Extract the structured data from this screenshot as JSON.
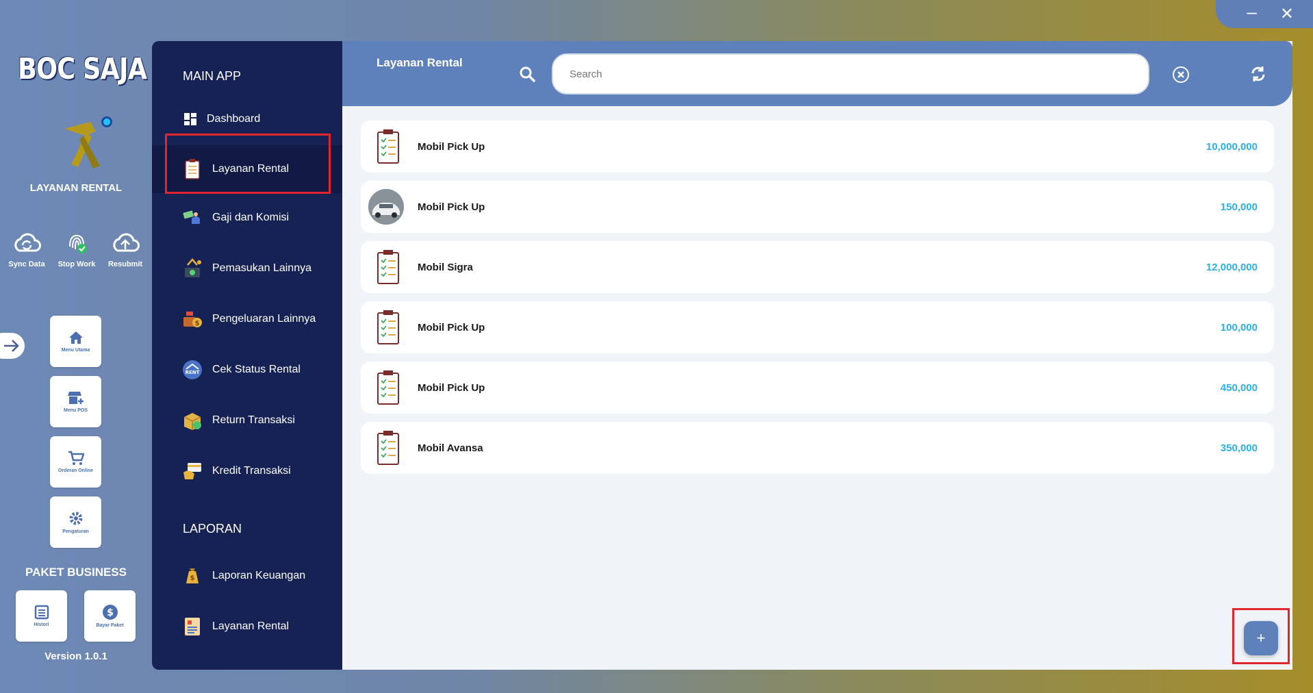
{
  "window": {
    "minimize_label": "–",
    "close_label": "✕"
  },
  "rail": {
    "brand": "BOC SAJA",
    "app_title": "LAYANAN RENTAL",
    "quick_actions": [
      {
        "label": "Sync Data",
        "icon": "sync-cloud-icon"
      },
      {
        "label": "Stop Work",
        "icon": "fingerprint-icon"
      },
      {
        "label": "Resubmit",
        "icon": "upload-cloud-icon"
      }
    ],
    "tiles": [
      {
        "label": "Menu Utama",
        "icon": "home-icon"
      },
      {
        "label": "Menu POS",
        "icon": "store-icon"
      },
      {
        "label": "Orderan Online",
        "icon": "cart-icon"
      },
      {
        "label": "Pengaturan",
        "icon": "gear-icon"
      }
    ],
    "paket_title": "PAKET BUSINESS",
    "paket_tiles": [
      {
        "label": "Histori",
        "icon": "list-icon"
      },
      {
        "label": "Bayar Paket",
        "icon": "dollar-icon"
      }
    ],
    "version": "Version 1.0.1"
  },
  "nav": {
    "main_section": "MAIN APP",
    "items": [
      {
        "label": "Dashboard",
        "icon": "dashboard-icon"
      },
      {
        "label": "Layanan Rental",
        "icon": "clipboard-icon",
        "active": true
      },
      {
        "label": "Gaji dan Komisi",
        "icon": "money-hand-icon"
      },
      {
        "label": "Pemasukan Lainnya",
        "icon": "income-icon"
      },
      {
        "label": "Pengeluaran Lainnya",
        "icon": "expense-icon"
      },
      {
        "label": "Cek Status Rental",
        "icon": "rent-icon"
      },
      {
        "label": "Return Transaksi",
        "icon": "return-box-icon"
      },
      {
        "label": "Kredit Transaksi",
        "icon": "credit-card-icon"
      }
    ],
    "report_section": "LAPORAN",
    "report_items": [
      {
        "label": "Laporan Keuangan",
        "icon": "money-bag-icon"
      },
      {
        "label": "Layanan Rental",
        "icon": "report-icon"
      }
    ]
  },
  "header": {
    "title": "Layanan Rental",
    "search_placeholder": "Search"
  },
  "rentals": [
    {
      "name": "Mobil Pick Up",
      "price": "10,000,000",
      "thumb": "clipboard"
    },
    {
      "name": "Mobil Pick Up",
      "price": "150,000",
      "thumb": "photo"
    },
    {
      "name": "Mobil Sigra",
      "price": "12,000,000",
      "thumb": "clipboard"
    },
    {
      "name": "Mobil Pick Up",
      "price": "100,000",
      "thumb": "clipboard"
    },
    {
      "name": "Mobil Pick Up",
      "price": "450,000",
      "thumb": "clipboard"
    },
    {
      "name": "Mobil Avansa",
      "price": "350,000",
      "thumb": "clipboard"
    }
  ],
  "fab_label": "+",
  "colors": {
    "accent": "#5e80bb",
    "nav_bg": "#172254",
    "price": "#2eb0e3",
    "highlight": "#e0252f"
  }
}
